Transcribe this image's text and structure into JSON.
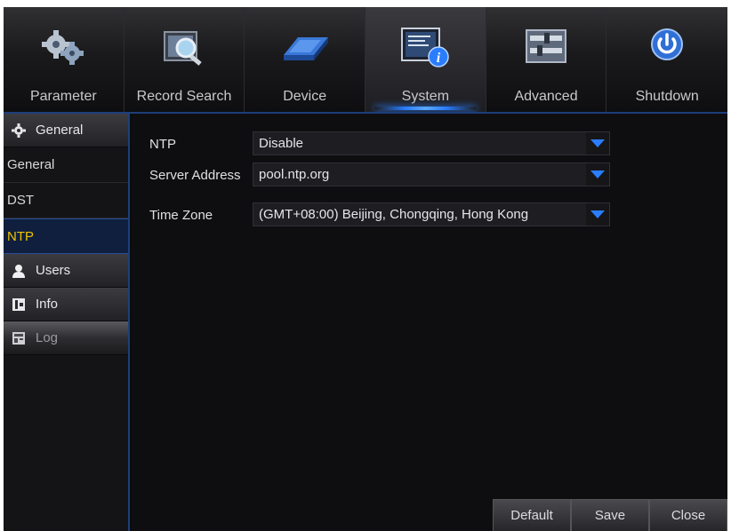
{
  "topmenu": {
    "tabs": [
      {
        "label": "Parameter",
        "icon": "gears-icon"
      },
      {
        "label": "Record Search",
        "icon": "record-search-icon"
      },
      {
        "label": "Device",
        "icon": "hard-drive-icon"
      },
      {
        "label": "System",
        "icon": "system-info-icon",
        "active": true
      },
      {
        "label": "Advanced",
        "icon": "sliders-icon"
      },
      {
        "label": "Shutdown",
        "icon": "power-icon"
      }
    ]
  },
  "sidebar": {
    "general_group": "General",
    "general_items": [
      "General",
      "DST",
      "NTP"
    ],
    "selected_item": "NTP",
    "users_group": "Users",
    "info_group": "Info",
    "log_group": "Log"
  },
  "form": {
    "ntp_label": "NTP",
    "ntp_value": "Disable",
    "server_label": "Server Address",
    "server_value": "pool.ntp.org",
    "timezone_label": "Time Zone",
    "timezone_value": "(GMT+08:00) Beijing, Chongqing, Hong Kong"
  },
  "buttons": {
    "default_label": "Default",
    "save_label": "Save",
    "close_label": "Close"
  },
  "colors": {
    "accent_blue": "#2a7dff",
    "selected_text": "#f2c200",
    "background": "#0e0e10"
  }
}
